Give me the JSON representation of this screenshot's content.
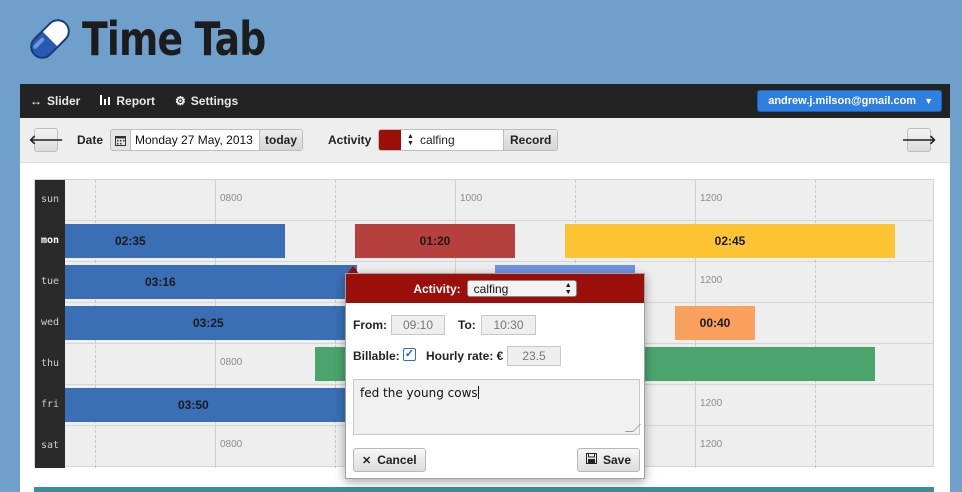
{
  "app": {
    "title": "Time Tab"
  },
  "nav": {
    "items": [
      {
        "label": "Slider",
        "icon": "arrows-horizontal-icon"
      },
      {
        "label": "Report",
        "icon": "bar-chart-icon"
      },
      {
        "label": "Settings",
        "icon": "gear-icon"
      }
    ],
    "account": "andrew.j.milson@gmail.com"
  },
  "toolbar": {
    "date_label": "Date",
    "date_value": "Monday 27 May, 2013",
    "today_label": "today",
    "activity_label": "Activity",
    "activity_value": "calfing",
    "activity_color": "#9a0f0a",
    "record_label": "Record"
  },
  "grid": {
    "days": [
      "sun",
      "mon",
      "tue",
      "wed",
      "thu",
      "fri",
      "sat"
    ],
    "active_day": "mon",
    "hour_labels": [
      "0800",
      "1000",
      "1200"
    ],
    "entries": [
      {
        "day": "mon",
        "duration": "02:35",
        "color": "#3a6fb6"
      },
      {
        "day": "mon",
        "duration": "01:20",
        "color": "#b5403d"
      },
      {
        "day": "mon",
        "duration": "02:45",
        "color": "#fec433"
      },
      {
        "day": "tue",
        "duration": "03:16",
        "color": "#3a6fb6"
      },
      {
        "day": "tue",
        "duration": "",
        "color": "#6f94e0"
      },
      {
        "day": "wed",
        "duration": "03:25",
        "color": "#3a6fb6"
      },
      {
        "day": "wed",
        "duration": "00:40",
        "color": "#f9a05c"
      },
      {
        "day": "thu",
        "duration": "",
        "color": "#4aa46c"
      },
      {
        "day": "fri",
        "duration": "03:50",
        "color": "#3a6fb6"
      }
    ]
  },
  "popup": {
    "activity_label": "Activity:",
    "activity_value": "calfing",
    "from_label": "From:",
    "from_value": "09:10",
    "to_label": "To:",
    "to_value": "10:30",
    "billable_label": "Billable:",
    "billable_checked": true,
    "rate_label": "Hourly rate: €",
    "rate_value": "23.5",
    "note": "fed the young cows",
    "cancel_label": "Cancel",
    "save_label": "Save"
  }
}
